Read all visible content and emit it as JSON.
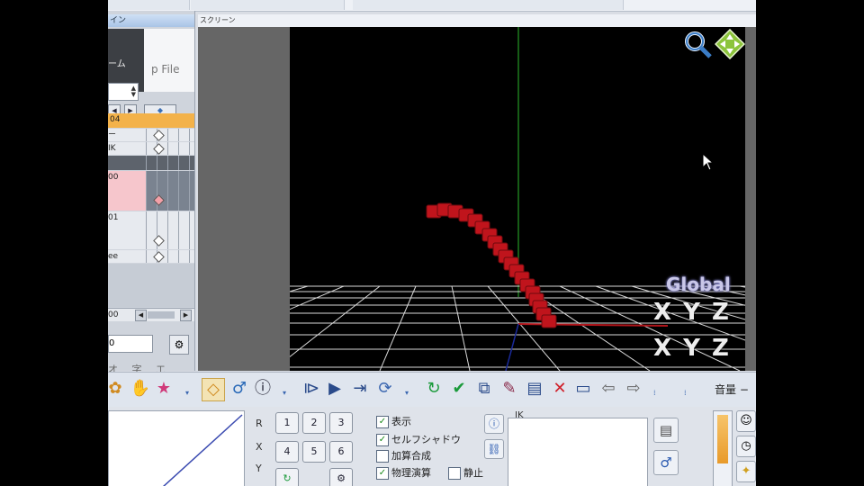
{
  "screen": {
    "title": "スクリーン",
    "coord_label": "Global",
    "xyz_top": "X Y Z",
    "xyz_bottom": "X Y Z"
  },
  "left_panel": {
    "title_fragment": "イン",
    "frame_fragment": "ーム",
    "file_fragment": "p File",
    "selected_row": "04",
    "rows": [
      "ー",
      "IK",
      "00",
      "01",
      "ee"
    ],
    "scroll_value": "00",
    "num_value": "0",
    "jp_fragment": "オ 字 エ フ"
  },
  "toolbar": {
    "volume_label": "音量 −"
  },
  "bottom": {
    "axes": [
      "R",
      "X",
      "Y"
    ],
    "num_buttons": [
      "1",
      "2",
      "3",
      "4",
      "5",
      "6"
    ],
    "checks": [
      {
        "label": "表示",
        "checked": true
      },
      {
        "label": "セルフシャドウ",
        "checked": true
      },
      {
        "label": "加算合成",
        "checked": false
      },
      {
        "label": "物理演算",
        "checked": true
      },
      {
        "label": "静止",
        "checked": false
      }
    ],
    "ik_label": "IK"
  },
  "colors": {
    "accent": "#3a66b0",
    "selected_row": "#f3b24a",
    "pink_row": "#f6c6cc",
    "model": "#c0141c"
  },
  "icons": [
    "zoom-icon",
    "move-icon",
    "cursor-icon",
    "play-icon",
    "refresh-icon",
    "check-icon",
    "delete-icon",
    "gear-icon"
  ]
}
